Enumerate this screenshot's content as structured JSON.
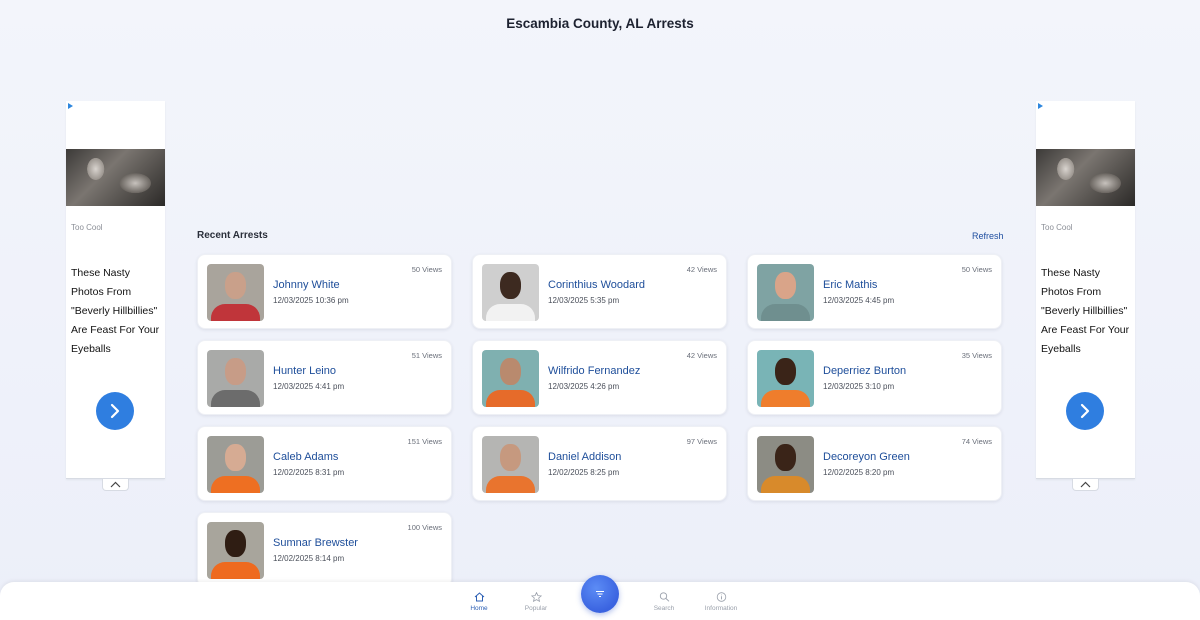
{
  "page": {
    "title": "Escambia County, AL Arrests"
  },
  "ads": {
    "brand": "Too Cool",
    "headline": "These Nasty Photos From \"Beverly Hillbillies\" Are Feast For Your Eyeballs",
    "cta_icon": "chevron-right-icon",
    "collapse_icon": "chevron-up-icon"
  },
  "section": {
    "title": "Recent Arrests",
    "refresh_label": "Refresh"
  },
  "arrests": [
    {
      "name": "Johnny White",
      "date": "12/03/2025 10:36 pm",
      "views": "50 Views",
      "bg": "#a9a49c",
      "skin": "#c9a08a",
      "shirt": "#c0353a"
    },
    {
      "name": "Corinthius Woodard",
      "date": "12/03/2025 5:35 pm",
      "views": "42 Views",
      "bg": "#cfcfcf",
      "skin": "#3d2a20",
      "shirt": "#f2f2f2"
    },
    {
      "name": "Eric Mathis",
      "date": "12/03/2025 4:45 pm",
      "views": "50 Views",
      "bg": "#7fa3a3",
      "skin": "#d9a489",
      "shirt": "#6f8f8f"
    },
    {
      "name": "Hunter Leino",
      "date": "12/03/2025 4:41 pm",
      "views": "51 Views",
      "bg": "#a9aaa8",
      "skin": "#c79c87",
      "shirt": "#6c6c6c"
    },
    {
      "name": "Wilfrido Fernandez",
      "date": "12/03/2025 4:26 pm",
      "views": "42 Views",
      "bg": "#7fb0b0",
      "skin": "#b98a6e",
      "shirt": "#e66b2a"
    },
    {
      "name": "Deperriez Burton",
      "date": "12/03/2025 3:10 pm",
      "views": "35 Views",
      "bg": "#79b4b6",
      "skin": "#3a2418",
      "shirt": "#ef7d2c"
    },
    {
      "name": "Caleb Adams",
      "date": "12/02/2025 8:31 pm",
      "views": "151 Views",
      "bg": "#9c9c96",
      "skin": "#d6ab93",
      "shirt": "#ee6f22"
    },
    {
      "name": "Daniel Addison",
      "date": "12/02/2025 8:25 pm",
      "views": "97 Views",
      "bg": "#b5b5b3",
      "skin": "#c6997f",
      "shirt": "#e9742e"
    },
    {
      "name": "Decoreyon Green",
      "date": "12/02/2025 8:20 pm",
      "views": "74 Views",
      "bg": "#8c8c84",
      "skin": "#3a2418",
      "shirt": "#d88a2b"
    },
    {
      "name": "Sumnar Brewster",
      "date": "12/02/2025 8:14 pm",
      "views": "100 Views",
      "bg": "#a8a59c",
      "skin": "#2f1d13",
      "shirt": "#ee6a1f"
    }
  ],
  "nav": {
    "items": [
      {
        "label": "Home",
        "icon": "home-icon",
        "active": true
      },
      {
        "label": "Popular",
        "icon": "star-icon",
        "active": false
      },
      {
        "label": "Search",
        "icon": "search-icon",
        "active": false
      },
      {
        "label": "Information",
        "icon": "info-icon",
        "active": false
      }
    ],
    "fab_icon": "filter-icon"
  }
}
